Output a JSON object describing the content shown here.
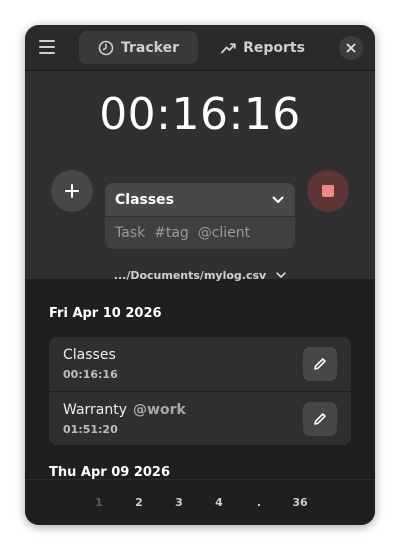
{
  "header": {
    "tabs": [
      {
        "label": "Tracker",
        "icon": "clock-icon",
        "active": true
      },
      {
        "label": "Reports",
        "icon": "trend-icon",
        "active": false
      }
    ]
  },
  "timer": {
    "elapsed": "00:16:16",
    "project": "Classes",
    "task_placeholder": "Task  #tag  @client",
    "log_file": ".../Documents/mylog.csv",
    "stop_color": "#f08a89"
  },
  "days": [
    {
      "date": "Fri Apr 10 2026",
      "entries": [
        {
          "title": "Classes",
          "tag": "",
          "duration": "00:16:16"
        },
        {
          "title": "Warranty",
          "tag": "@work",
          "duration": "01:51:20"
        }
      ]
    },
    {
      "date": "Thu Apr 09 2026",
      "entries": []
    }
  ],
  "pagination": {
    "pages": [
      "1",
      "2",
      "3",
      "4",
      ".",
      "36"
    ],
    "current": "1"
  }
}
